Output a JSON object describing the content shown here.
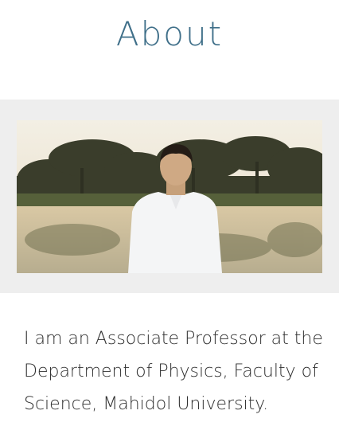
{
  "page": {
    "title": "About",
    "bio_text": "I am an Associate Professor at the Department of Physics, Faculty of Science, Mahidol University."
  },
  "colors": {
    "title": "#3f6f89",
    "band_background": "#eeeeee",
    "text": "#2f2f2f"
  }
}
